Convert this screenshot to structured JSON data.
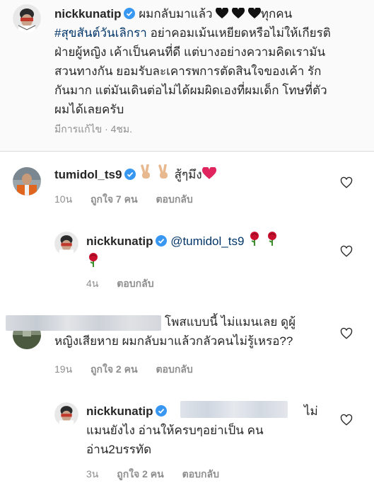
{
  "caption": {
    "username": "nickkunatip",
    "intro": "ผมกลับมาแล้ว",
    "after_hearts": "ทุกคน",
    "hashtag": "#สุขสันต์วันเลิกรา",
    "line1_rest": " อย่าคอมเม้นเหยียดหรือไม่ให้เกียรติ",
    "line2": "ฝ่ายผู้หญิง เค้าเป็นคนที่ดี แต่บางอย่างความคิดเรามัน",
    "line3": "สวนทางกัน ยอมรับละเคารพการตัดสินใจของเค้า รัก",
    "line4": "กันมาก แต่มันเดินต่อไม่ได้ผมผิดเองที่ผมเด็ก โทษที่ตัว",
    "line5": "ผมได้เลยครับ",
    "meta": "มีการแก้ไข · 4ชม.",
    "heart_color": "#262626"
  },
  "comments": [
    {
      "username": "tumidol_ts9",
      "text": "สู้ๆมึง",
      "time": "10น",
      "likes": "ถูกใจ 7 คน",
      "reply": "ตอบกลับ"
    },
    {
      "username": "nickkunatip",
      "mention": "@tumidol_ts9",
      "time": "4น",
      "reply": "ตอบกลับ"
    },
    {
      "line1": "โพสแบบนี้ ไม่แมนเลย ดูผู้",
      "line2": "หญิงเสียหาย ผมกลับมาแล้วกลัวคนไม่รู้เหรอ??",
      "time": "19น",
      "likes": "ถูกใจ 2 คน",
      "reply": "ตอบกลับ"
    },
    {
      "username": "nickkunatip",
      "line1_end": "ไม่",
      "line2": "แมนยังไง อ่านให้ครบๆอย่าเป็น คน",
      "line3": "อ่าน2บรรทัด",
      "time": "3น",
      "likes": "ถูกใจ 2 คน",
      "reply": "ตอบกลับ"
    }
  ],
  "colors": {
    "verified": "#3897f0",
    "link": "#003569",
    "meta": "#8e8e8e",
    "rose": "#c8102e",
    "red_heart": "#e0245e"
  }
}
